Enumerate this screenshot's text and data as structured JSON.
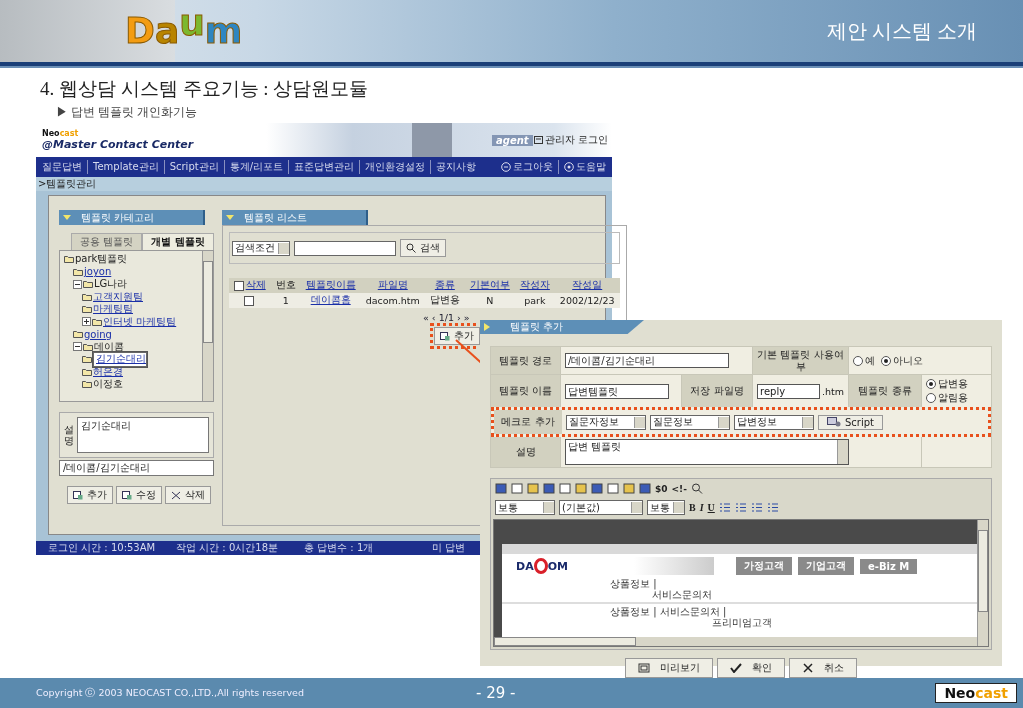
{
  "slide": {
    "title": "제안 시스템 소개",
    "logo_letters": [
      {
        "char": "D",
        "color": "#f39c12"
      },
      {
        "char": "a",
        "color": "#b88400"
      },
      {
        "char": "u",
        "color": "#7cb82f"
      },
      {
        "char": "m",
        "color": "#2e86c1"
      }
    ],
    "heading": "4. 웹상담 시스템 주요기능 : 상담원모듈",
    "subheading": "▶ 답변 템플릿 개인화기능"
  },
  "app": {
    "brand": {
      "part_1": "Neo",
      "part_2": "cast"
    },
    "product": "@Master Contact Center",
    "banner_word": "agent",
    "admin_login": "관리자 로그인",
    "nav": [
      "질문답변",
      "Template관리",
      "Script관리",
      "통계/리포트",
      "표준답변관리",
      "개인환경설정",
      "공지사항"
    ],
    "nav_right": [
      {
        "label": "로그아웃",
        "kind": "logout"
      },
      {
        "label": "도움말",
        "kind": "help"
      }
    ],
    "breadcrumb": ">템플릿관리",
    "category_panel": {
      "title": "템플릿 카테고리",
      "tabs": [
        {
          "label": "공용 템플릿",
          "selected": false
        },
        {
          "label": "개별 템플릿",
          "selected": true
        }
      ],
      "tree": {
        "label": "park템플릿",
        "link": false,
        "selected": false,
        "children": [
          {
            "label": "joyon",
            "link": true,
            "selected": false
          },
          {
            "label": "LG나라",
            "link": false,
            "selected": false,
            "expanded": true,
            "children": [
              {
                "label": "고객지원팀",
                "link": true,
                "selected": false
              },
              {
                "label": "마케팅팀",
                "link": true,
                "selected": false
              },
              {
                "label": "인터넷 마케팅팀",
                "link": true,
                "selected": false,
                "expanded": false
              }
            ]
          },
          {
            "label": "going",
            "link": true,
            "selected": false
          },
          {
            "label": "데이콤",
            "link": false,
            "selected": false,
            "expanded": true,
            "children": [
              {
                "label": "김기순대리",
                "link": true,
                "selected": true
              },
              {
                "label": "허은경",
                "link": true,
                "selected": false
              },
              {
                "label": "이정호",
                "link": false,
                "selected": false
              }
            ]
          }
        ]
      },
      "description_label": "설명",
      "description": "김기순대리",
      "path": "/데이콤/김기순대리",
      "buttons": [
        {
          "label": "추가",
          "kind": "add"
        },
        {
          "label": "수정",
          "kind": "edit"
        },
        {
          "label": "삭제",
          "kind": "delete"
        }
      ]
    },
    "list_panel": {
      "title": "템플릿 리스트",
      "search_select": "검색조건",
      "search_button": "검색",
      "columns": [
        {
          "label": "삭제",
          "link": true,
          "checkbox": true,
          "checked": false
        },
        {
          "label": "번호",
          "link": false
        },
        {
          "label": "템플릿이름",
          "link": true
        },
        {
          "label": "파일명",
          "link": true
        },
        {
          "label": "종류",
          "link": true
        },
        {
          "label": "기본여부",
          "link": true
        },
        {
          "label": "작성자",
          "link": true
        },
        {
          "label": "작성일",
          "link": true
        }
      ],
      "rows": [
        {
          "cells": [
            {
              "kind": "checkbox",
              "checked": false
            },
            {
              "text": "1",
              "link": false
            },
            {
              "text": "데이콤홈",
              "link": true
            },
            {
              "text": "dacom.htm",
              "link": false
            },
            {
              "text": "답변용",
              "link": false
            },
            {
              "text": "N",
              "link": false
            },
            {
              "text": "park",
              "link": false
            },
            {
              "text": "2002/12/23",
              "link": false
            }
          ]
        }
      ],
      "pager": "« ‹ 1/1 › »",
      "add_button": "추가"
    },
    "status_bar": [
      "로그인 시간 : 10:53AM",
      "작업 시간 : 0시간18분",
      "총 답변수 : 1개",
      "미 답변"
    ]
  },
  "dialog": {
    "title": "템플릿 추가",
    "path_label": "템플릿 경로",
    "path_value": "/데이콤/김기순대리",
    "default_label": "기본 템플릿 사용여부",
    "default_options": [
      {
        "label": "예",
        "selected": false
      },
      {
        "label": "아니오",
        "selected": true
      }
    ],
    "name_label": "템플릿 이름",
    "name_value": "답변템플릿",
    "file_label": "저장 파일명",
    "file_value": "reply",
    "file_suffix": ".htm",
    "type_label": "템플릿 종류",
    "type_options": [
      {
        "label": "답변용",
        "selected": true
      },
      {
        "label": "알림용",
        "selected": false
      }
    ],
    "macro_label": "메크로 추가",
    "macro_selects": [
      "질문자정보",
      "질문정보",
      "답변정보"
    ],
    "script_button": "Script",
    "desc_label": "설명",
    "desc_value": "답변 템플릿",
    "editor": {
      "selects": [
        "보통",
        "(기본값)",
        "보통"
      ],
      "codes": [
        "$0",
        "<!-"
      ],
      "format_buttons": [
        "B",
        "I",
        "U"
      ],
      "preview": {
        "logo_left": "DA",
        "logo_right": "OM",
        "menu": [
          "가정고객",
          "기업고객",
          "e-Biz M"
        ],
        "lines": [
          "상품정보 |",
          "서비스문의처",
          "상품정보 | 서비스문의처 |",
          "프리미엄고객"
        ]
      }
    },
    "buttons": [
      {
        "label": "미리보기",
        "kind": "preview"
      },
      {
        "label": "확인",
        "kind": "ok"
      },
      {
        "label": "취소",
        "kind": "cancel"
      }
    ]
  },
  "footer": {
    "copyright": "Copyright ⓒ 2003 NEOCAST CO.,LTD.,All rights reserved",
    "page": "- 29 -",
    "logo": {
      "part_1": "Neo",
      "part_2": "cast"
    }
  }
}
